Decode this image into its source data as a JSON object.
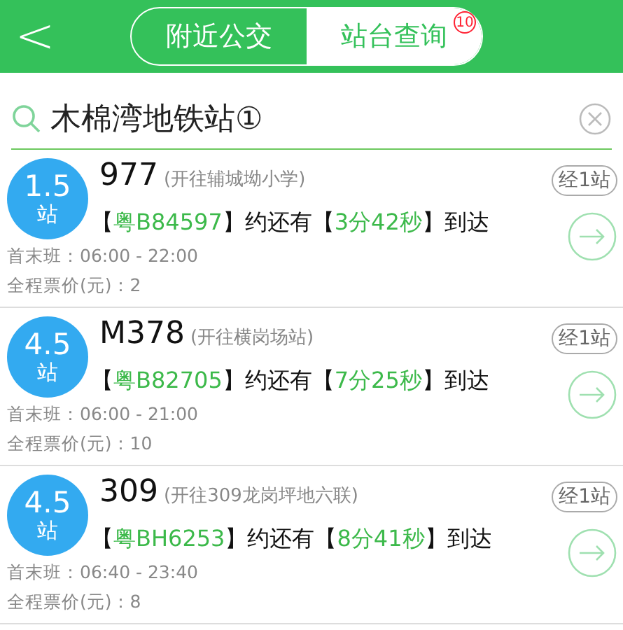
{
  "header": {
    "back": "<",
    "tabs": [
      {
        "label": "附近公交",
        "selected": false
      },
      {
        "label": "站台查询",
        "selected": true,
        "badge": "10"
      }
    ]
  },
  "search": {
    "value": "木棉湾地铁站①"
  },
  "routes": [
    {
      "distance": "1.5",
      "unit": "站",
      "name": "977",
      "destination": "(开往辅城坳小学)",
      "stops": "经1站",
      "prefix": "【",
      "plate": "粤B84597",
      "middle": "】约还有【",
      "eta": "3分42秒",
      "suffix": "】到达",
      "schedule": "首末班：06:00 - 22:00",
      "fare": "全程票价(元)：2"
    },
    {
      "distance": "4.5",
      "unit": "站",
      "name": "M378",
      "destination": "(开往横岗场站)",
      "stops": "经1站",
      "prefix": "【",
      "plate": "粤B82705",
      "middle": "】约还有【",
      "eta": "7分25秒",
      "suffix": "】到达",
      "schedule": "首末班：06:00 - 21:00",
      "fare": "全程票价(元)：10"
    },
    {
      "distance": "4.5",
      "unit": "站",
      "name": "309",
      "destination": "(开往309龙岗坪地六联)",
      "stops": "经1站",
      "prefix": "【",
      "plate": "粤BH6253",
      "middle": "】约还有【",
      "eta": "8分41秒",
      "suffix": "】到达",
      "schedule": "首末班：06:40 - 23:40",
      "fare": "全程票价(元)：8"
    }
  ]
}
